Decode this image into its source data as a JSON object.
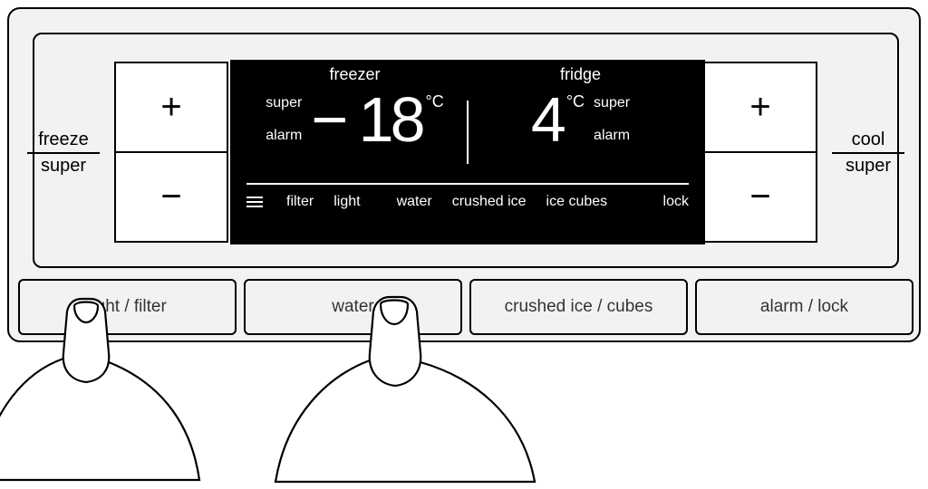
{
  "sideLabels": {
    "left": {
      "top": "freeze",
      "bottom": "super"
    },
    "right": {
      "top": "cool",
      "bottom": "super"
    }
  },
  "pmButtons": {
    "plus": "+",
    "minus": "−"
  },
  "lcd": {
    "freezer": {
      "title": "freezer",
      "indicators": {
        "super": "super",
        "alarm": "alarm"
      },
      "value": "− 18",
      "unit": "°C"
    },
    "fridge": {
      "title": "fridge",
      "indicators": {
        "super": "super",
        "alarm": "alarm"
      },
      "value": "4",
      "unit": "°C"
    },
    "bottomItems": {
      "filter": "filter",
      "light": "light",
      "water": "water",
      "crushed": "crushed ice",
      "cubes": "ice cubes",
      "lock": "lock"
    }
  },
  "bottomButtons": {
    "lightFilter": "light / filter",
    "water": "water",
    "crushedCubes": "crushed ice / cubes",
    "alarmLock": "alarm / lock"
  }
}
